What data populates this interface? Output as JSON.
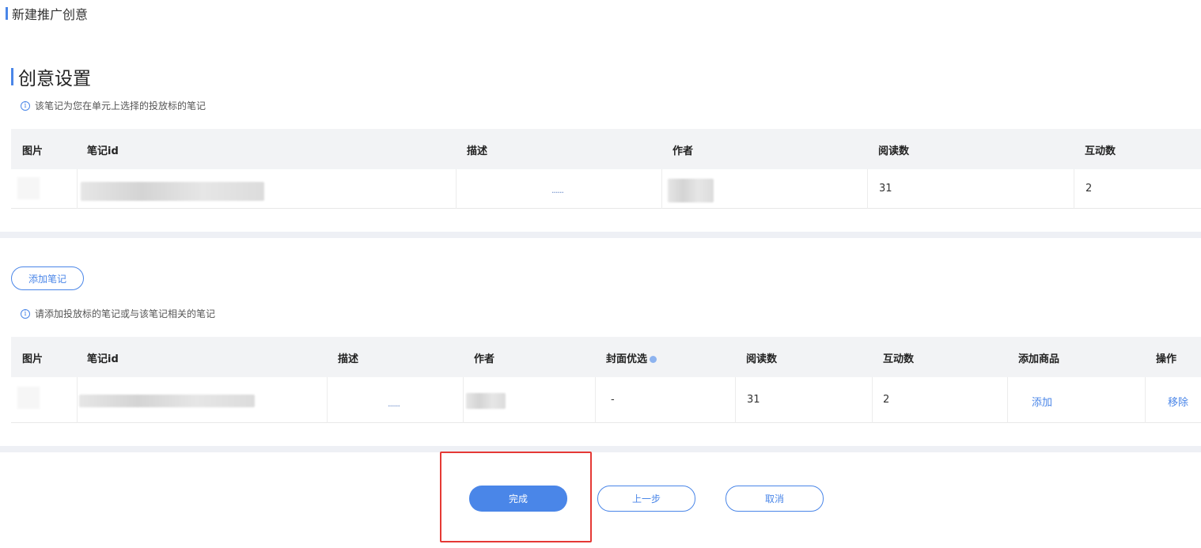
{
  "header": {
    "title": "新建推广创意"
  },
  "section": {
    "title": "创意设置",
    "hint": "该笔记为您在单元上选择的投放标的笔记"
  },
  "table1": {
    "columns": [
      "图片",
      "笔记id",
      "描述",
      "作者",
      "阅读数",
      "互动数"
    ],
    "row": {
      "desc": "......",
      "reads": "31",
      "interactions": "2"
    }
  },
  "add_note": {
    "button": "添加笔记",
    "hint": "请添加投放标的笔记或与该笔记相关的笔记"
  },
  "table2": {
    "columns": [
      "图片",
      "笔记id",
      "描述",
      "作者",
      "封面优选",
      "阅读数",
      "互动数",
      "添加商品",
      "操作"
    ],
    "row": {
      "desc": "......",
      "cover": "-",
      "reads": "31",
      "interactions": "2",
      "add_product": "添加",
      "action": "移除"
    }
  },
  "footer": {
    "done": "完成",
    "prev": "上一步",
    "cancel": "取消"
  },
  "colors": {
    "accent": "#4a86e8",
    "highlight": "#e53935"
  }
}
